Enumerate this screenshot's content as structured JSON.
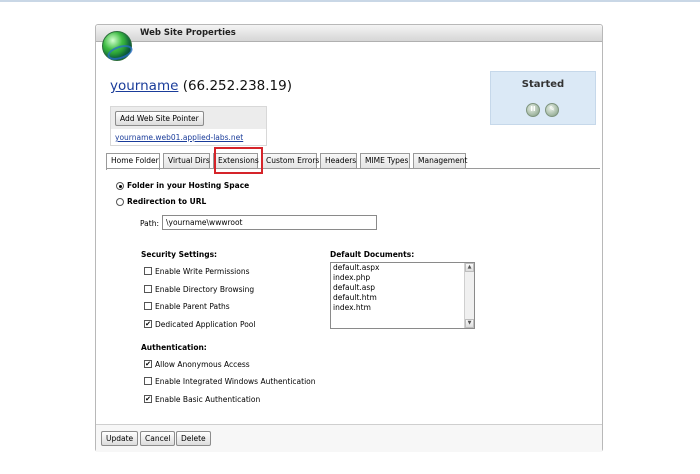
{
  "window": {
    "title": "Web Site Properties"
  },
  "site": {
    "name": "yourname",
    "ip": "(66.252.238.19)"
  },
  "pointer": {
    "add_button": "Add Web Site Pointer",
    "link": "yourname.web01.applied-labs.net"
  },
  "status": {
    "text": "Started",
    "pause_glyph": "II",
    "edit_glyph": "✎"
  },
  "tabs": [
    {
      "label": "Home Folder",
      "active": true
    },
    {
      "label": "Virtual Dirs"
    },
    {
      "label": "Extensions",
      "highlighted": true
    },
    {
      "label": "Custom Errors"
    },
    {
      "label": "Headers"
    },
    {
      "label": "MIME Types"
    },
    {
      "label": "Management"
    }
  ],
  "home": {
    "folder_option": "Folder in your Hosting Space",
    "redirect_option": "Redirection to URL",
    "selected": "folder",
    "path_label": "Path:",
    "path_value": "\\yourname\\wwwroot"
  },
  "security": {
    "title": "Security Settings:",
    "items": [
      {
        "label": "Enable Write Permissions",
        "checked": false
      },
      {
        "label": "Enable Directory Browsing",
        "checked": false
      },
      {
        "label": "Enable Parent Paths",
        "checked": false
      },
      {
        "label": "Dedicated Application Pool",
        "checked": true
      }
    ]
  },
  "default_docs": {
    "title": "Default Documents:",
    "items": [
      "default.aspx",
      "index.php",
      "default.asp",
      "default.htm",
      "index.htm"
    ]
  },
  "auth": {
    "title": "Authentication:",
    "items": [
      {
        "label": "Allow Anonymous Access",
        "checked": true
      },
      {
        "label": "Enable Integrated Windows Authentication",
        "checked": false
      },
      {
        "label": "Enable Basic Authentication",
        "checked": true
      }
    ]
  },
  "footer": {
    "update": "Update",
    "cancel": "Cancel",
    "delete": "Delete"
  },
  "colors": {
    "highlight": "#d5242a",
    "link": "#1a3c9a",
    "status_panel": "#dbe9f6"
  }
}
